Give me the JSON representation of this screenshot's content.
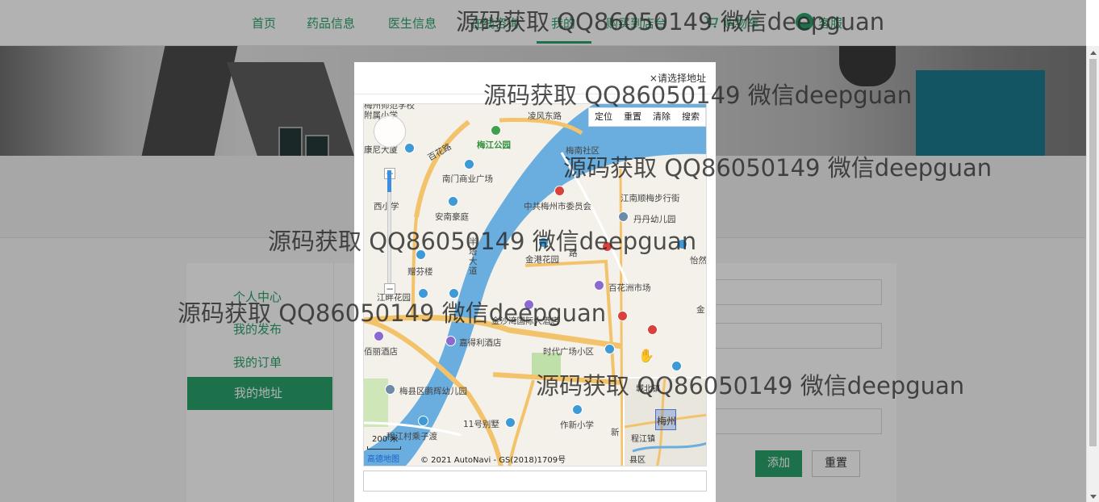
{
  "nav": {
    "items": [
      "首页",
      "药品信息",
      "医生信息",
      "在线咨询",
      "我的",
      "购买到店台",
      "购物车",
      "客服"
    ],
    "active_index": 4
  },
  "side_menu": {
    "items": [
      "个人中心",
      "我的发布",
      "我的订单",
      "我的地址"
    ],
    "active_index": 3
  },
  "form": {
    "add_label": "添加",
    "reset_label": "重置"
  },
  "modal": {
    "title": "请选择地址",
    "close_glyph": "×",
    "address_value": ""
  },
  "map": {
    "toolbar": [
      "定位",
      "重置",
      "清除",
      "搜索"
    ],
    "labels": {
      "lingfeng": "凌风东路",
      "school": "梅州师范学校附属小学",
      "meijiang_park": "梅江公园",
      "baihua": "百花路",
      "meinan": "梅南社区",
      "kangni": "康尼大厦",
      "nanmen": "南门商业广场",
      "ccp": "中共梅州市委员会",
      "jiangnan": "江南顺梅步行街",
      "xi_school": "西小学",
      "anan": "安南豪庭",
      "dandan": "丹丹幼儿园",
      "jingang": "金港花园",
      "yiran": "怡然楼",
      "zengfen": "赠芬楼",
      "baihuazhou": "百花洲市场",
      "jiangpan": "江畔花园",
      "jinsha": "金沙湾国际大酒店",
      "jiade": "嘉得利酒店",
      "bali": "佰丽酒店",
      "shidai": "时代广场小区",
      "penghui": "梅县区鹏辉幼儿园",
      "bieshu": "11号别墅",
      "zuoxin": "作新小学",
      "chengjiang": "程江村乘子渡",
      "street": "半塔大道",
      "lu": "路",
      "jin": "金",
      "xin": "新"
    },
    "minimap_labels": [
      "城北镇",
      "梅州",
      "程江镇",
      "县区"
    ],
    "scale_text": "200 米",
    "copyright": "© 2021 AutoNavi - GS(2018)1709号",
    "logo": "高德地图",
    "zoom_level_fraction": 0.18
  },
  "watermark": "源码获取 QQ86050149 微信deepguan",
  "colors": {
    "brand_green": "#2aa36b",
    "river_blue": "#6aaedf",
    "road_orange": "#f3c36b"
  }
}
